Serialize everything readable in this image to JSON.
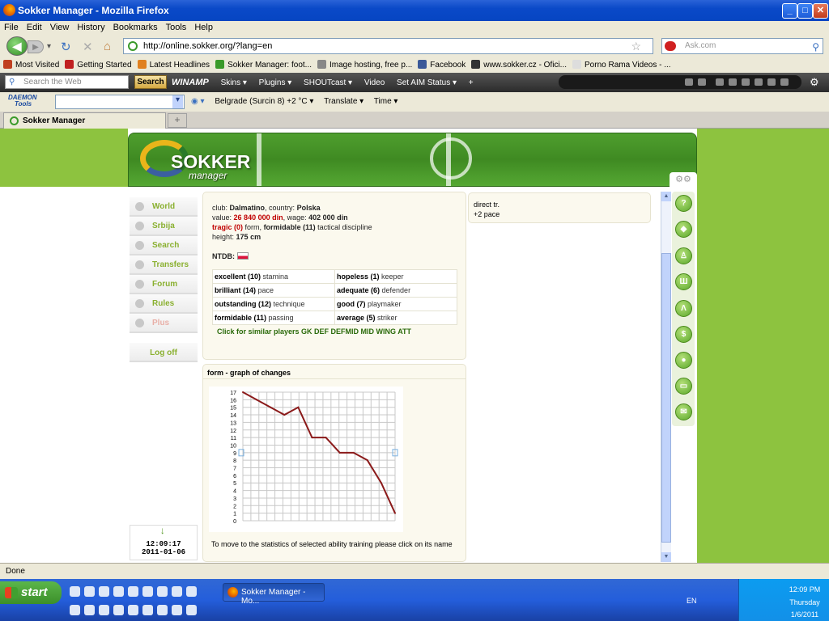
{
  "window": {
    "title": "Sokker Manager - Mozilla Firefox",
    "min": "_",
    "max": "□",
    "close": "✕"
  },
  "menu": [
    "File",
    "Edit",
    "View",
    "History",
    "Bookmarks",
    "Tools",
    "Help"
  ],
  "nav": {
    "url": "http://online.sokker.org/?lang=en",
    "search_placeholder": "Ask.com"
  },
  "bookmarks": [
    {
      "label": "Most Visited",
      "color": "#c04020"
    },
    {
      "label": "Getting Started",
      "color": "#c02020"
    },
    {
      "label": "Latest Headlines",
      "color": "#e08020"
    },
    {
      "label": "Sokker Manager: foot...",
      "color": "#3a9a2a"
    },
    {
      "label": "Image hosting, free p...",
      "color": "#888888"
    },
    {
      "label": "Facebook",
      "color": "#3b5998"
    },
    {
      "label": "www.sokker.cz - Ofici...",
      "color": "#333333"
    },
    {
      "label": "Porno Rama Videos - ...",
      "color": "#dddddd"
    }
  ],
  "winamp": {
    "search_placeholder": "Search the Web",
    "search_btn": "Search",
    "logo": "WINAMP",
    "items": [
      "Skins ▾",
      "Plugins ▾",
      "SHOUTcast ▾",
      "Video",
      "Set AIM Status ▾",
      "+"
    ]
  },
  "daemon": {
    "logo_line1": "DAEMON",
    "logo_line2": "Tools",
    "items": [
      "Belgrade (Surcin  8)  +2 °C ▾",
      "Translate ▾",
      "Time ▾"
    ]
  },
  "tab": {
    "label": "Sokker Manager",
    "new": "+"
  },
  "site": {
    "logo": "SOKKER",
    "logo_sub": "manager"
  },
  "sidenav": [
    {
      "label": "World",
      "key": "world"
    },
    {
      "label": "Srbija",
      "key": "srbija"
    },
    {
      "label": "Search",
      "key": "search"
    },
    {
      "label": "Transfers",
      "key": "transfers"
    },
    {
      "label": "Forum",
      "key": "forum"
    },
    {
      "label": "Rules",
      "key": "rules"
    },
    {
      "label": "Plus",
      "key": "plus"
    }
  ],
  "logoff": "Log off",
  "clock": {
    "time": "12:09:17",
    "date": "2011-01-06"
  },
  "player": {
    "club_label": "club:",
    "club": "Dalmatino",
    "country_label": ", country:",
    "country": "Polska",
    "value_label": "value:",
    "value": "26 840 000 din",
    "wage_label": ", wage:",
    "wage": "402 000 din",
    "form_level": "tragic (0)",
    "form_label": "form,",
    "td_level": "formidable (11)",
    "td_label": "tactical discipline",
    "height_label": "height:",
    "height": "175 cm",
    "ntdb": "NTDB:"
  },
  "skills": [
    [
      {
        "level": "excellent (10)",
        "name": "stamina"
      },
      {
        "level": "hopeless (1)",
        "name": "keeper"
      }
    ],
    [
      {
        "level": "brilliant (14)",
        "name": "pace"
      },
      {
        "level": "adequate (6)",
        "name": "defender"
      }
    ],
    [
      {
        "level": "outstanding (12)",
        "name": "technique"
      },
      {
        "level": "good (7)",
        "name": "playmaker"
      }
    ],
    [
      {
        "level": "formidable (11)",
        "name": "passing"
      },
      {
        "level": "average (5)",
        "name": "striker"
      }
    ]
  ],
  "similar": "Click for similar players GK DEF DEFMID MID WING ATT",
  "graph": {
    "title": "form - graph of changes",
    "note": "To move to the statistics of selected ability training please click on its name"
  },
  "chart_data": {
    "type": "line",
    "title": "form - graph of changes",
    "xlabel": "",
    "ylabel": "",
    "ylim": [
      0,
      17
    ],
    "yticks": [
      0,
      1,
      2,
      3,
      4,
      5,
      6,
      7,
      8,
      9,
      10,
      11,
      12,
      13,
      14,
      15,
      16,
      17
    ],
    "grid": true,
    "x": [
      0,
      1,
      2,
      3,
      4,
      5,
      6,
      7,
      8,
      9,
      10,
      11
    ],
    "values": [
      17,
      16,
      15,
      14,
      15,
      11,
      11,
      9,
      9,
      8,
      5,
      1
    ],
    "color": "#8b1a1a"
  },
  "right_panel": {
    "line1": "direct tr.",
    "line2": "+2 pace"
  },
  "status": "Done",
  "taskbar": {
    "start": "start",
    "task": "Sokker Manager - Mo...",
    "lang": "EN",
    "time": "12:09 PM",
    "day": "Thursday",
    "date": "1/6/2011"
  }
}
